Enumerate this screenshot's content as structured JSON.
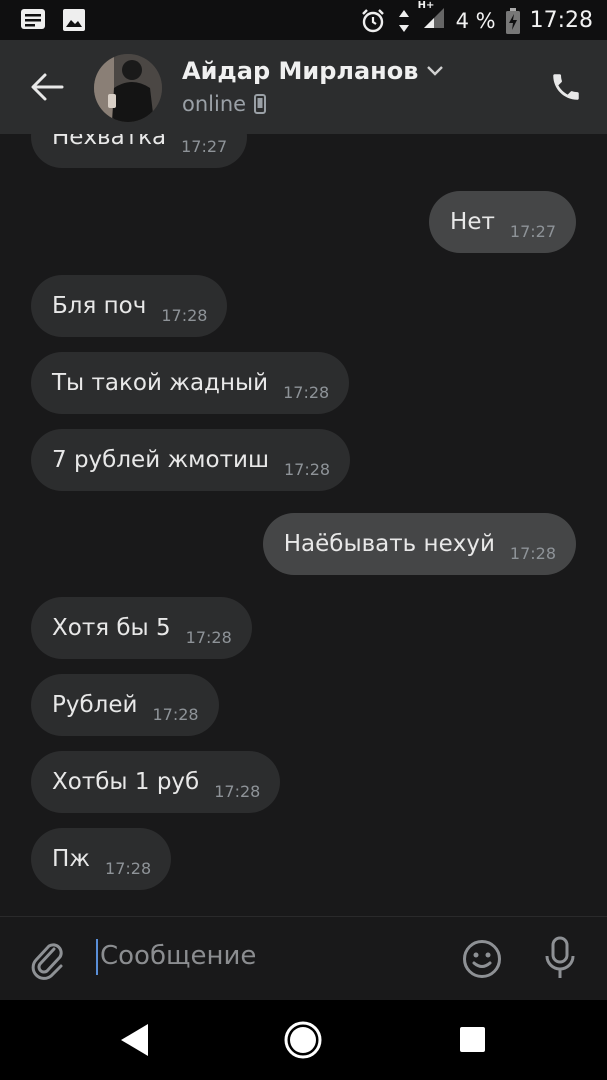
{
  "status_bar": {
    "battery": "4 %",
    "time": "17:28",
    "network": "H+"
  },
  "header": {
    "contact_name": "Айдар Мирланов",
    "presence": "online"
  },
  "messages": [
    {
      "text": "Нехватка",
      "time": "17:27",
      "direction": "in"
    },
    {
      "text": "Нет",
      "time": "17:27",
      "direction": "out"
    },
    {
      "text": "Бля поч",
      "time": "17:28",
      "direction": "in"
    },
    {
      "text": "Ты такой жадный",
      "time": "17:28",
      "direction": "in"
    },
    {
      "text": "7 рублей жмотиш",
      "time": "17:28",
      "direction": "in"
    },
    {
      "text": "Наёбывать нехуй",
      "time": "17:28",
      "direction": "out"
    },
    {
      "text": "Хотя бы 5",
      "time": "17:28",
      "direction": "in"
    },
    {
      "text": "Рублей",
      "time": "17:28",
      "direction": "in"
    },
    {
      "text": "Хотбы 1 руб",
      "time": "17:28",
      "direction": "in"
    },
    {
      "text": "Пж",
      "time": "17:28",
      "direction": "in"
    }
  ],
  "composer": {
    "placeholder": "Сообщение"
  },
  "colors": {
    "background": "#19191a",
    "header": "#2c2d2e",
    "incoming_bubble": "#2c2d2e",
    "outgoing_bubble": "#454647",
    "caret": "#5a8fd8"
  }
}
